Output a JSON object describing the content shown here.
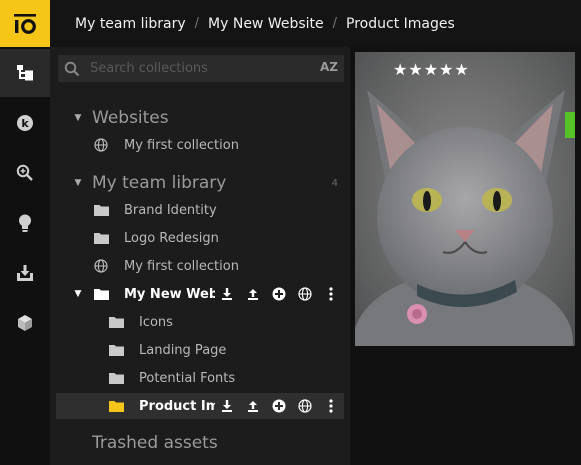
{
  "app": {
    "logo_text": "io",
    "accent_color": "#f5c518"
  },
  "rail": {
    "items": [
      {
        "icon": "folder-tree-icon",
        "active": true
      },
      {
        "icon": "kodi-icon",
        "active": false
      },
      {
        "icon": "zoom-icon",
        "active": false
      },
      {
        "icon": "lightbulb-icon",
        "active": false
      },
      {
        "icon": "download-box-icon",
        "active": false
      },
      {
        "icon": "cube-icon",
        "active": false
      }
    ]
  },
  "breadcrumb": {
    "items": [
      "My team library",
      "My New Website",
      "Product Images"
    ],
    "separator": "/"
  },
  "search": {
    "placeholder": "Search collections",
    "sort_label": "AZ"
  },
  "tree": {
    "websites_title": "Websites",
    "websites_item": "My first collection",
    "team_title": "My team library",
    "team_count": "4",
    "brand_identity": "Brand Identity",
    "logo_redesign": "Logo Redesign",
    "team_first_collection": "My first collection",
    "new_website": "My New Website",
    "icons": "Icons",
    "landing_page": "Landing Page",
    "potential_fonts": "Potential Fonts",
    "product_images": "Product Images",
    "trashed_title": "Trashed assets"
  },
  "preview": {
    "rating_stars": "★★★★★",
    "rating_value": 5,
    "rating_max": 5
  }
}
